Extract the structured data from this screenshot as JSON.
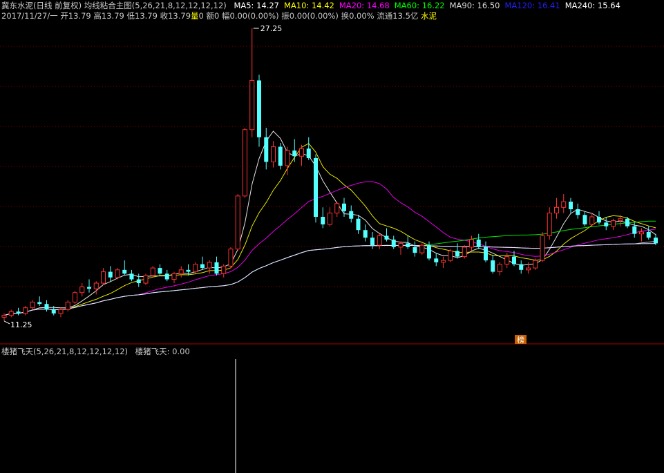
{
  "header": {
    "stock_title": "冀东水泥(日线 前复权) 均线粘合主图(5,26,21,8,12,12,12,12)",
    "mas": [
      {
        "label": "MA5: 14.27",
        "color": "#ffffff"
      },
      {
        "label": "MA10: 14.42",
        "color": "#ffff00"
      },
      {
        "label": "MA20: 14.68",
        "color": "#ff00ff"
      },
      {
        "label": "MA60: 16.22",
        "color": "#00ff00"
      },
      {
        "label": "MA90: 16.50",
        "color": "#dddddd"
      },
      {
        "label": "MA120: 16.41",
        "color": "#2020ff"
      },
      {
        "label": "MA240: 15.64",
        "color": "#ffffff"
      }
    ]
  },
  "quote": {
    "date": "2017/11/27/一",
    "open": "开13.79",
    "high": "高13.79",
    "low": "低13.79",
    "close": "收13.79",
    "vol_label": "量",
    "vol_value": "0",
    "amount": "额0",
    "amplitude": "幅0.00(0.00%)",
    "swing": "振0.00(0.00%)",
    "turnover": "换0.00%",
    "float": "流通13.5亿",
    "sector": "水泥"
  },
  "lower_panel": {
    "indicator_title": "楼猪飞天(5,26,21,8,12,12,12,12)",
    "indicator_value": "楼猪飞天: 0.00"
  },
  "marker": {
    "text": "榜"
  },
  "colors": {
    "up": "#ff3232",
    "down": "#54ffff",
    "grid": "#8a0000",
    "divider": "#b00000"
  },
  "chart_data": {
    "type": "candlestick",
    "y_labels": {
      "high": "27.25",
      "low": "11.25"
    },
    "candles": [
      [
        12.0,
        12.2,
        11.8,
        12.1
      ],
      [
        12.1,
        12.4,
        12.0,
        12.3
      ],
      [
        12.3,
        12.5,
        12.1,
        12.2
      ],
      [
        12.2,
        12.6,
        12.1,
        12.5
      ],
      [
        12.5,
        12.9,
        12.4,
        12.8
      ],
      [
        12.8,
        13.1,
        12.6,
        12.7
      ],
      [
        12.7,
        12.9,
        12.3,
        12.4
      ],
      [
        12.4,
        12.6,
        12.1,
        12.2
      ],
      [
        12.2,
        12.5,
        12.0,
        12.4
      ],
      [
        12.4,
        12.9,
        12.3,
        12.8
      ],
      [
        12.8,
        13.4,
        12.7,
        13.3
      ],
      [
        13.3,
        13.8,
        13.1,
        13.6
      ],
      [
        13.6,
        14.0,
        13.3,
        13.5
      ],
      [
        13.5,
        13.9,
        13.2,
        13.8
      ],
      [
        13.8,
        14.6,
        13.7,
        14.4
      ],
      [
        14.4,
        14.7,
        13.9,
        14.1
      ],
      [
        14.1,
        14.6,
        14.0,
        14.5
      ],
      [
        14.5,
        15.0,
        14.2,
        14.3
      ],
      [
        14.3,
        14.5,
        13.9,
        14.0
      ],
      [
        14.0,
        14.3,
        13.6,
        13.8
      ],
      [
        13.8,
        14.3,
        13.7,
        14.2
      ],
      [
        14.2,
        14.7,
        14.1,
        14.6
      ],
      [
        14.6,
        14.8,
        14.2,
        14.3
      ],
      [
        14.3,
        14.5,
        13.9,
        14.0
      ],
      [
        14.0,
        14.4,
        13.8,
        14.3
      ],
      [
        14.3,
        14.7,
        14.1,
        14.5
      ],
      [
        14.5,
        14.8,
        14.2,
        14.4
      ],
      [
        14.4,
        14.9,
        14.3,
        14.8
      ],
      [
        14.8,
        15.2,
        14.5,
        14.6
      ],
      [
        14.6,
        15.0,
        14.3,
        14.9
      ],
      [
        14.9,
        15.2,
        14.2,
        14.3
      ],
      [
        14.3,
        14.8,
        14.1,
        14.7
      ],
      [
        14.7,
        15.7,
        14.6,
        15.6
      ],
      [
        15.6,
        18.5,
        15.5,
        18.4
      ],
      [
        18.4,
        22.0,
        18.3,
        21.9
      ],
      [
        21.9,
        27.25,
        21.5,
        24.5
      ],
      [
        24.5,
        24.8,
        21.0,
        21.5
      ],
      [
        21.5,
        22.0,
        19.8,
        20.2
      ],
      [
        20.2,
        21.3,
        19.9,
        21.0
      ],
      [
        21.0,
        21.2,
        19.8,
        20.0
      ],
      [
        20.0,
        21.0,
        19.5,
        20.8
      ],
      [
        20.8,
        21.4,
        20.2,
        20.5
      ],
      [
        20.5,
        21.1,
        20.0,
        20.9
      ],
      [
        20.9,
        21.5,
        20.3,
        20.4
      ],
      [
        20.4,
        20.6,
        17.0,
        17.3
      ],
      [
        17.3,
        17.8,
        16.7,
        16.9
      ],
      [
        16.9,
        17.8,
        16.8,
        17.5
      ],
      [
        17.5,
        18.1,
        17.3,
        18.0
      ],
      [
        18.0,
        18.3,
        17.3,
        17.6
      ],
      [
        17.6,
        17.9,
        17.0,
        17.2
      ],
      [
        17.2,
        17.4,
        16.4,
        16.6
      ],
      [
        16.6,
        16.9,
        16.0,
        16.2
      ],
      [
        16.2,
        16.5,
        15.6,
        15.8
      ],
      [
        15.8,
        16.4,
        15.6,
        16.3
      ],
      [
        16.3,
        16.7,
        16.0,
        16.1
      ],
      [
        16.1,
        16.3,
        15.6,
        15.7
      ],
      [
        15.7,
        16.0,
        15.3,
        15.9
      ],
      [
        15.9,
        16.3,
        15.6,
        15.7
      ],
      [
        15.7,
        16.0,
        15.2,
        15.4
      ],
      [
        15.4,
        15.9,
        15.3,
        15.8
      ],
      [
        15.8,
        16.0,
        15.0,
        15.1
      ],
      [
        15.1,
        15.4,
        14.7,
        14.9
      ],
      [
        14.9,
        15.2,
        14.6,
        15.0
      ],
      [
        15.0,
        15.6,
        14.9,
        15.5
      ],
      [
        15.5,
        15.9,
        15.1,
        15.2
      ],
      [
        15.2,
        15.8,
        15.1,
        15.7
      ],
      [
        15.7,
        16.3,
        15.5,
        16.1
      ],
      [
        16.1,
        16.4,
        15.6,
        15.7
      ],
      [
        15.7,
        16.0,
        14.9,
        15.0
      ],
      [
        15.0,
        15.3,
        14.3,
        14.4
      ],
      [
        14.4,
        14.9,
        14.2,
        14.8
      ],
      [
        14.8,
        15.4,
        14.6,
        15.2
      ],
      [
        15.2,
        15.5,
        14.7,
        14.8
      ],
      [
        14.8,
        15.0,
        14.3,
        14.5
      ],
      [
        14.5,
        14.9,
        14.3,
        14.6
      ],
      [
        14.6,
        15.1,
        14.5,
        15.0
      ],
      [
        15.0,
        16.5,
        14.9,
        16.3
      ],
      [
        16.3,
        17.8,
        16.1,
        17.5
      ],
      [
        17.5,
        18.3,
        17.2,
        17.8
      ],
      [
        17.8,
        18.5,
        17.5,
        18.1
      ],
      [
        18.1,
        18.3,
        17.5,
        17.7
      ],
      [
        17.7,
        18.0,
        17.2,
        17.4
      ],
      [
        17.4,
        17.6,
        16.8,
        16.9
      ],
      [
        16.9,
        17.5,
        16.8,
        17.3
      ],
      [
        17.3,
        17.6,
        16.9,
        17.0
      ],
      [
        17.0,
        17.3,
        16.6,
        16.8
      ],
      [
        16.8,
        17.2,
        16.6,
        17.1
      ],
      [
        17.1,
        17.4,
        16.8,
        17.2
      ],
      [
        17.2,
        17.3,
        16.7,
        16.8
      ],
      [
        16.8,
        17.0,
        16.2,
        16.4
      ],
      [
        16.4,
        16.7,
        16.0,
        16.5
      ],
      [
        16.5,
        16.8,
        16.1,
        16.2
      ],
      [
        16.2,
        16.4,
        15.8,
        15.9
      ]
    ]
  }
}
